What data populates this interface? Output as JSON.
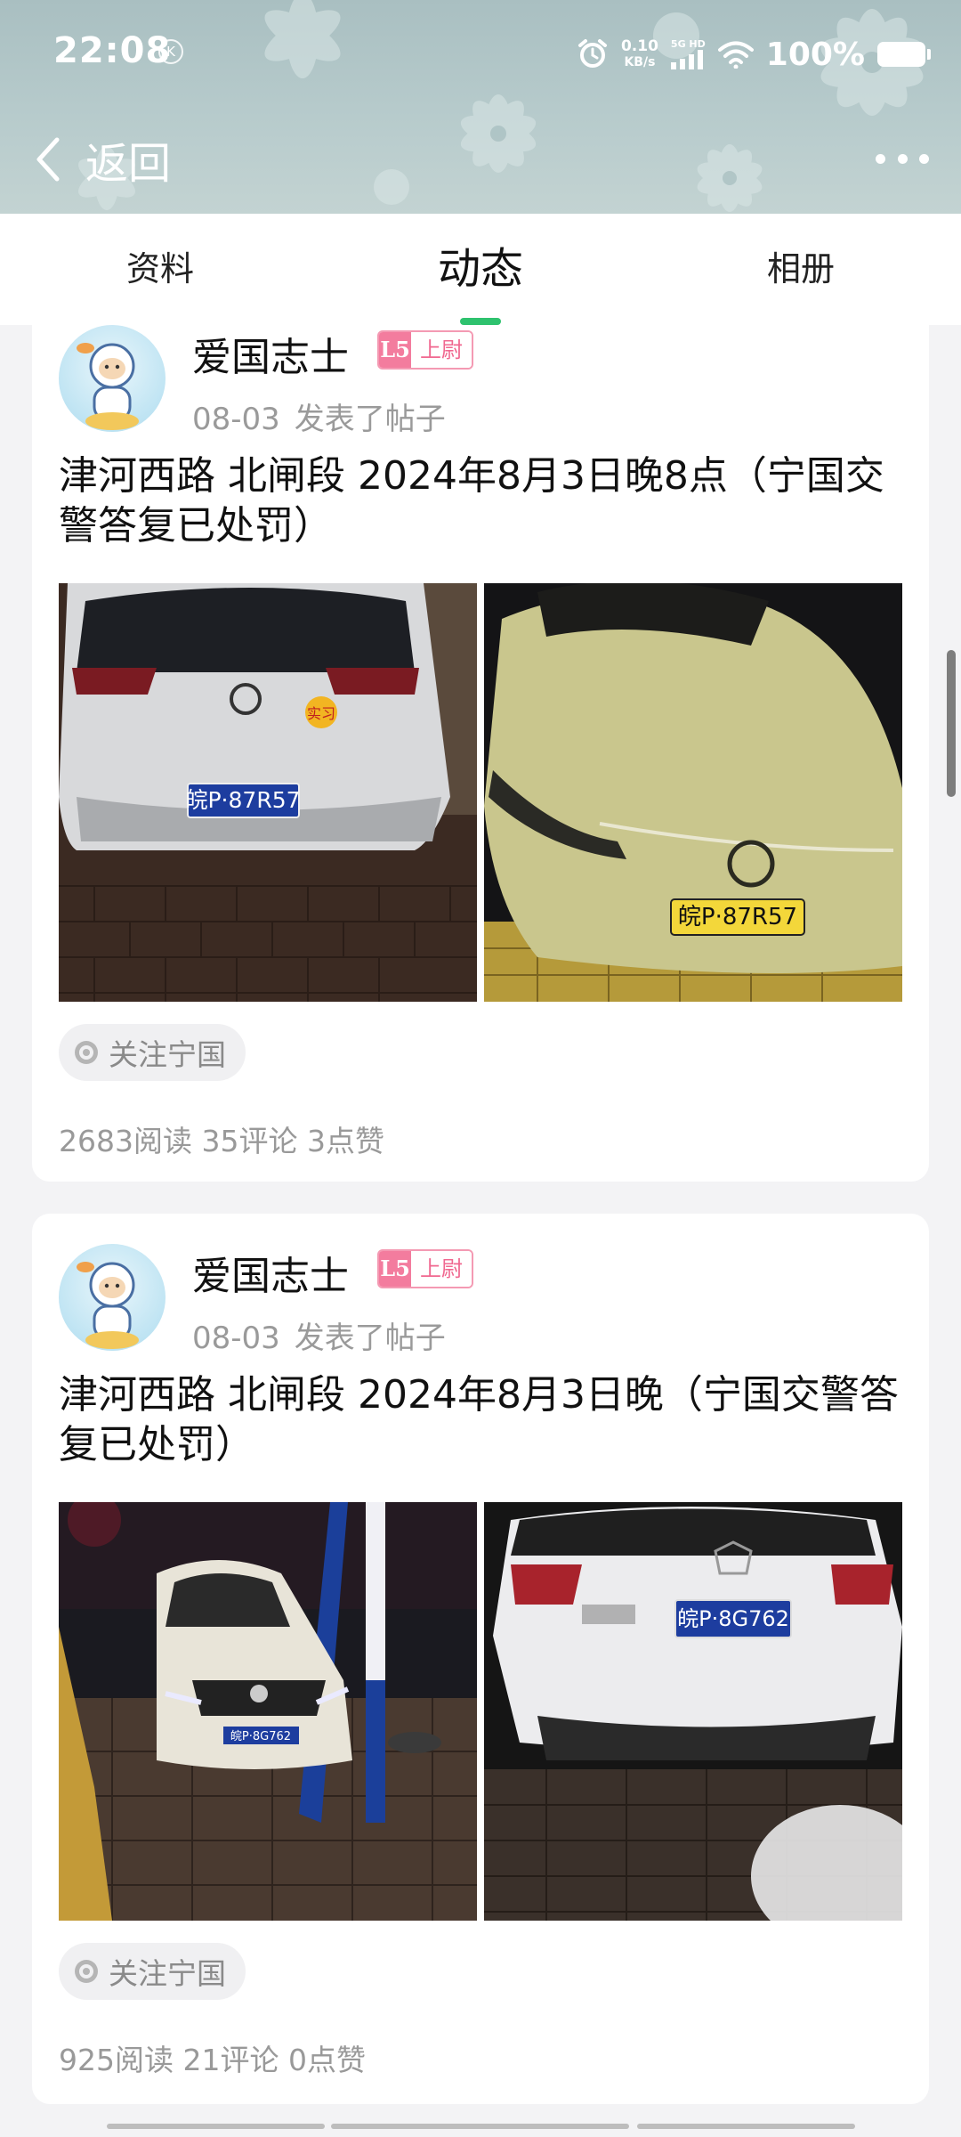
{
  "status_bar": {
    "time": "22:08",
    "k_badge": "K",
    "net_speed_value": "0.10",
    "net_speed_unit": "KB/s",
    "signal_label": "5G HD",
    "battery": "100%"
  },
  "navbar": {
    "back_label": "返回",
    "more_icon": "more-dots-icon"
  },
  "tabs": [
    {
      "label": "资料",
      "active": false
    },
    {
      "label": "动态",
      "active": true
    },
    {
      "label": "相册",
      "active": false
    }
  ],
  "accent_color": "#2ec26e",
  "posts": [
    {
      "user": "爱国志士",
      "rank_level": "L5",
      "rank_title": "上尉",
      "date": "08-03",
      "action": "发表了帖子",
      "title": "津河西路 北闸段 2024年8月3日晚8点（宁国交警答复已处罚）",
      "photos": [
        {
          "plate": "皖P·87R57",
          "badge": "实习",
          "logo": "VW"
        },
        {
          "plate": "皖P·87R57",
          "logo": "VW"
        }
      ],
      "topic": "关注宁国",
      "stats": "2683阅读 35评论 3点赞"
    },
    {
      "user": "爱国志士",
      "rank_level": "L5",
      "rank_title": "上尉",
      "date": "08-03",
      "action": "发表了帖子",
      "title": "津河西路 北闸段 2024年8月3日晚（宁国交警答复已处罚）",
      "photos": [
        {
          "plate": "皖P·8G762"
        },
        {
          "plate": "皖P·8G762"
        }
      ],
      "topic": "关注宁国",
      "stats": "925阅读 21评论 0点赞"
    }
  ]
}
